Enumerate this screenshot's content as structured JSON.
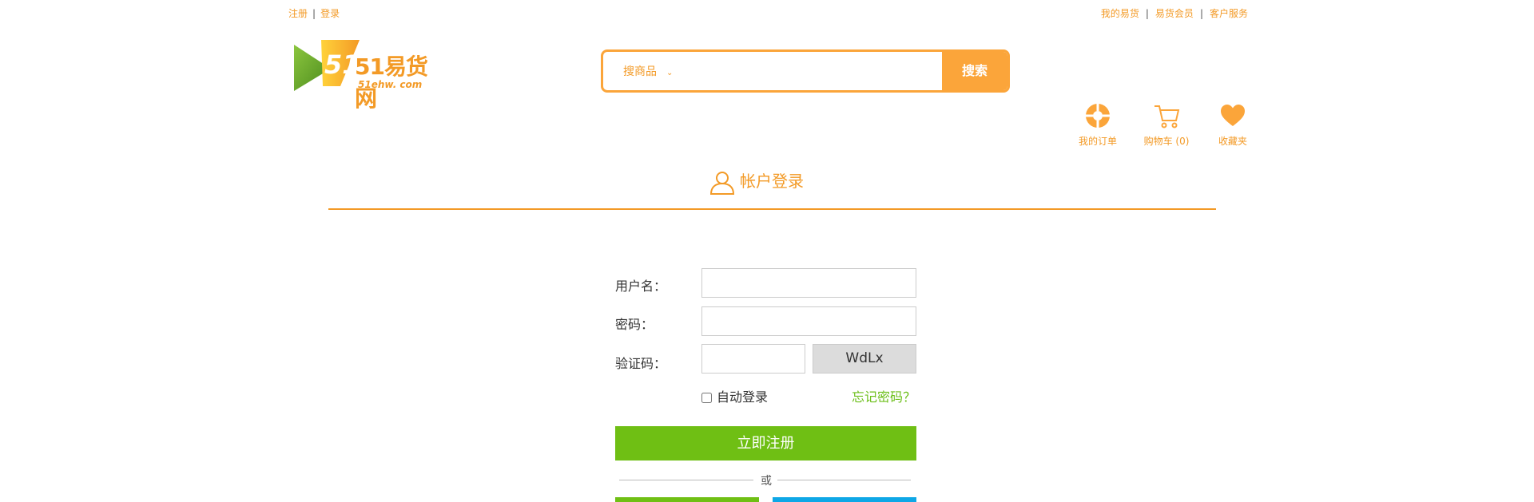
{
  "topbar": {
    "register": "注册",
    "login": "登录",
    "sep": "|",
    "my_yihuo": "我的易货",
    "member": "易货会员",
    "service": "客户服务"
  },
  "logo": {
    "main": "51易货网",
    "sub": "51ehw. com"
  },
  "search": {
    "category": "搜商品",
    "placeholder": "",
    "button": "搜索"
  },
  "user_links": {
    "orders": "我的订单",
    "cart": "购物车 (0)",
    "favorites": "收藏夹"
  },
  "login": {
    "title": "帐户登录",
    "username_label": "用户名：",
    "password_label": "密码：",
    "captcha_label": "验证码：",
    "captcha_code": "WdLx",
    "auto_login": "自动登录",
    "forgot": "忘记密码？",
    "submit": "立即注册",
    "or": "或"
  },
  "colors": {
    "accent": "#f39a26",
    "green": "#6fbf14",
    "blue": "#0ea7e6"
  },
  "icons": [
    "orders-icon",
    "cart-icon",
    "heart-icon",
    "user-icon",
    "chevron-down-icon"
  ]
}
